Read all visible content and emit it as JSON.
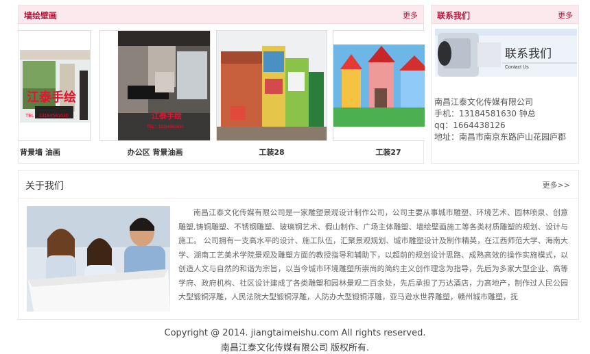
{
  "gallery": {
    "title": "墙绘壁画",
    "more": "更多",
    "items": [
      {
        "caption": "室 背景墙 油画",
        "watermark": "江泰手绘",
        "watermark_small": "TEL：13184581630"
      },
      {
        "caption": "办公区 背景油画",
        "watermark": "江泰手绘",
        "watermark_small": "TEL：13184581630"
      },
      {
        "caption": "工装28"
      },
      {
        "caption": "工装27"
      }
    ]
  },
  "contact": {
    "title": "联系我们",
    "more": "更多",
    "banner_title": "联系我们",
    "banner_sub": "Contact Us",
    "company": "南昌江泰文化传媒有限公司",
    "phone": "手机：13184581630 钟总",
    "qq": "qq：1664438126",
    "address": "地址：南昌市南京东路庐山花园庐郡"
  },
  "about": {
    "title": "关于我们",
    "more": "更多>>",
    "text": "南昌江泰文化传媒有限公司是一家雕塑景观设计制作公司，公司主要从事城市雕塑、环境艺术、园林喷泉、创意雕塑,铸铜雕塑、不锈钢雕塑、玻璃钢艺术、假山制作、广场主体雕塑、墙绘壁画施工等各类材质雕塑的规划、设计与施工。 公司拥有一支高水平的设计、施工队伍，汇聚景观规划、城市雕塑设计及制作精英，在江西师范大学、海南大学、湖南工艺美术学院景观及雕塑方面的教授指导和辅助下，以超前的规划设计思路、成熟高效的操作实施模式，以创造人文与自然的和谐为宗旨，以当今城市环境雕塑所崇尚的简约主义创作理念为指导，先后为多家大型企业、高等学府、政府机构、社区设计建成了各类雕塑和园林景观二百余处，先后承担了万达酒店，力高地产，制作过人民公园大型锻铜浮雕，人民法院大型锻铜浮雕，人防办大型锻铜浮雕，亚马逊水世界雕塑，赣州城市雕塑，抚"
  },
  "footer": {
    "copyright": "Copyright @ 2014. jiangtaimeishu.com All rights reserved.",
    "owner": "南昌江泰文化传媒有限公司 版权所有."
  }
}
